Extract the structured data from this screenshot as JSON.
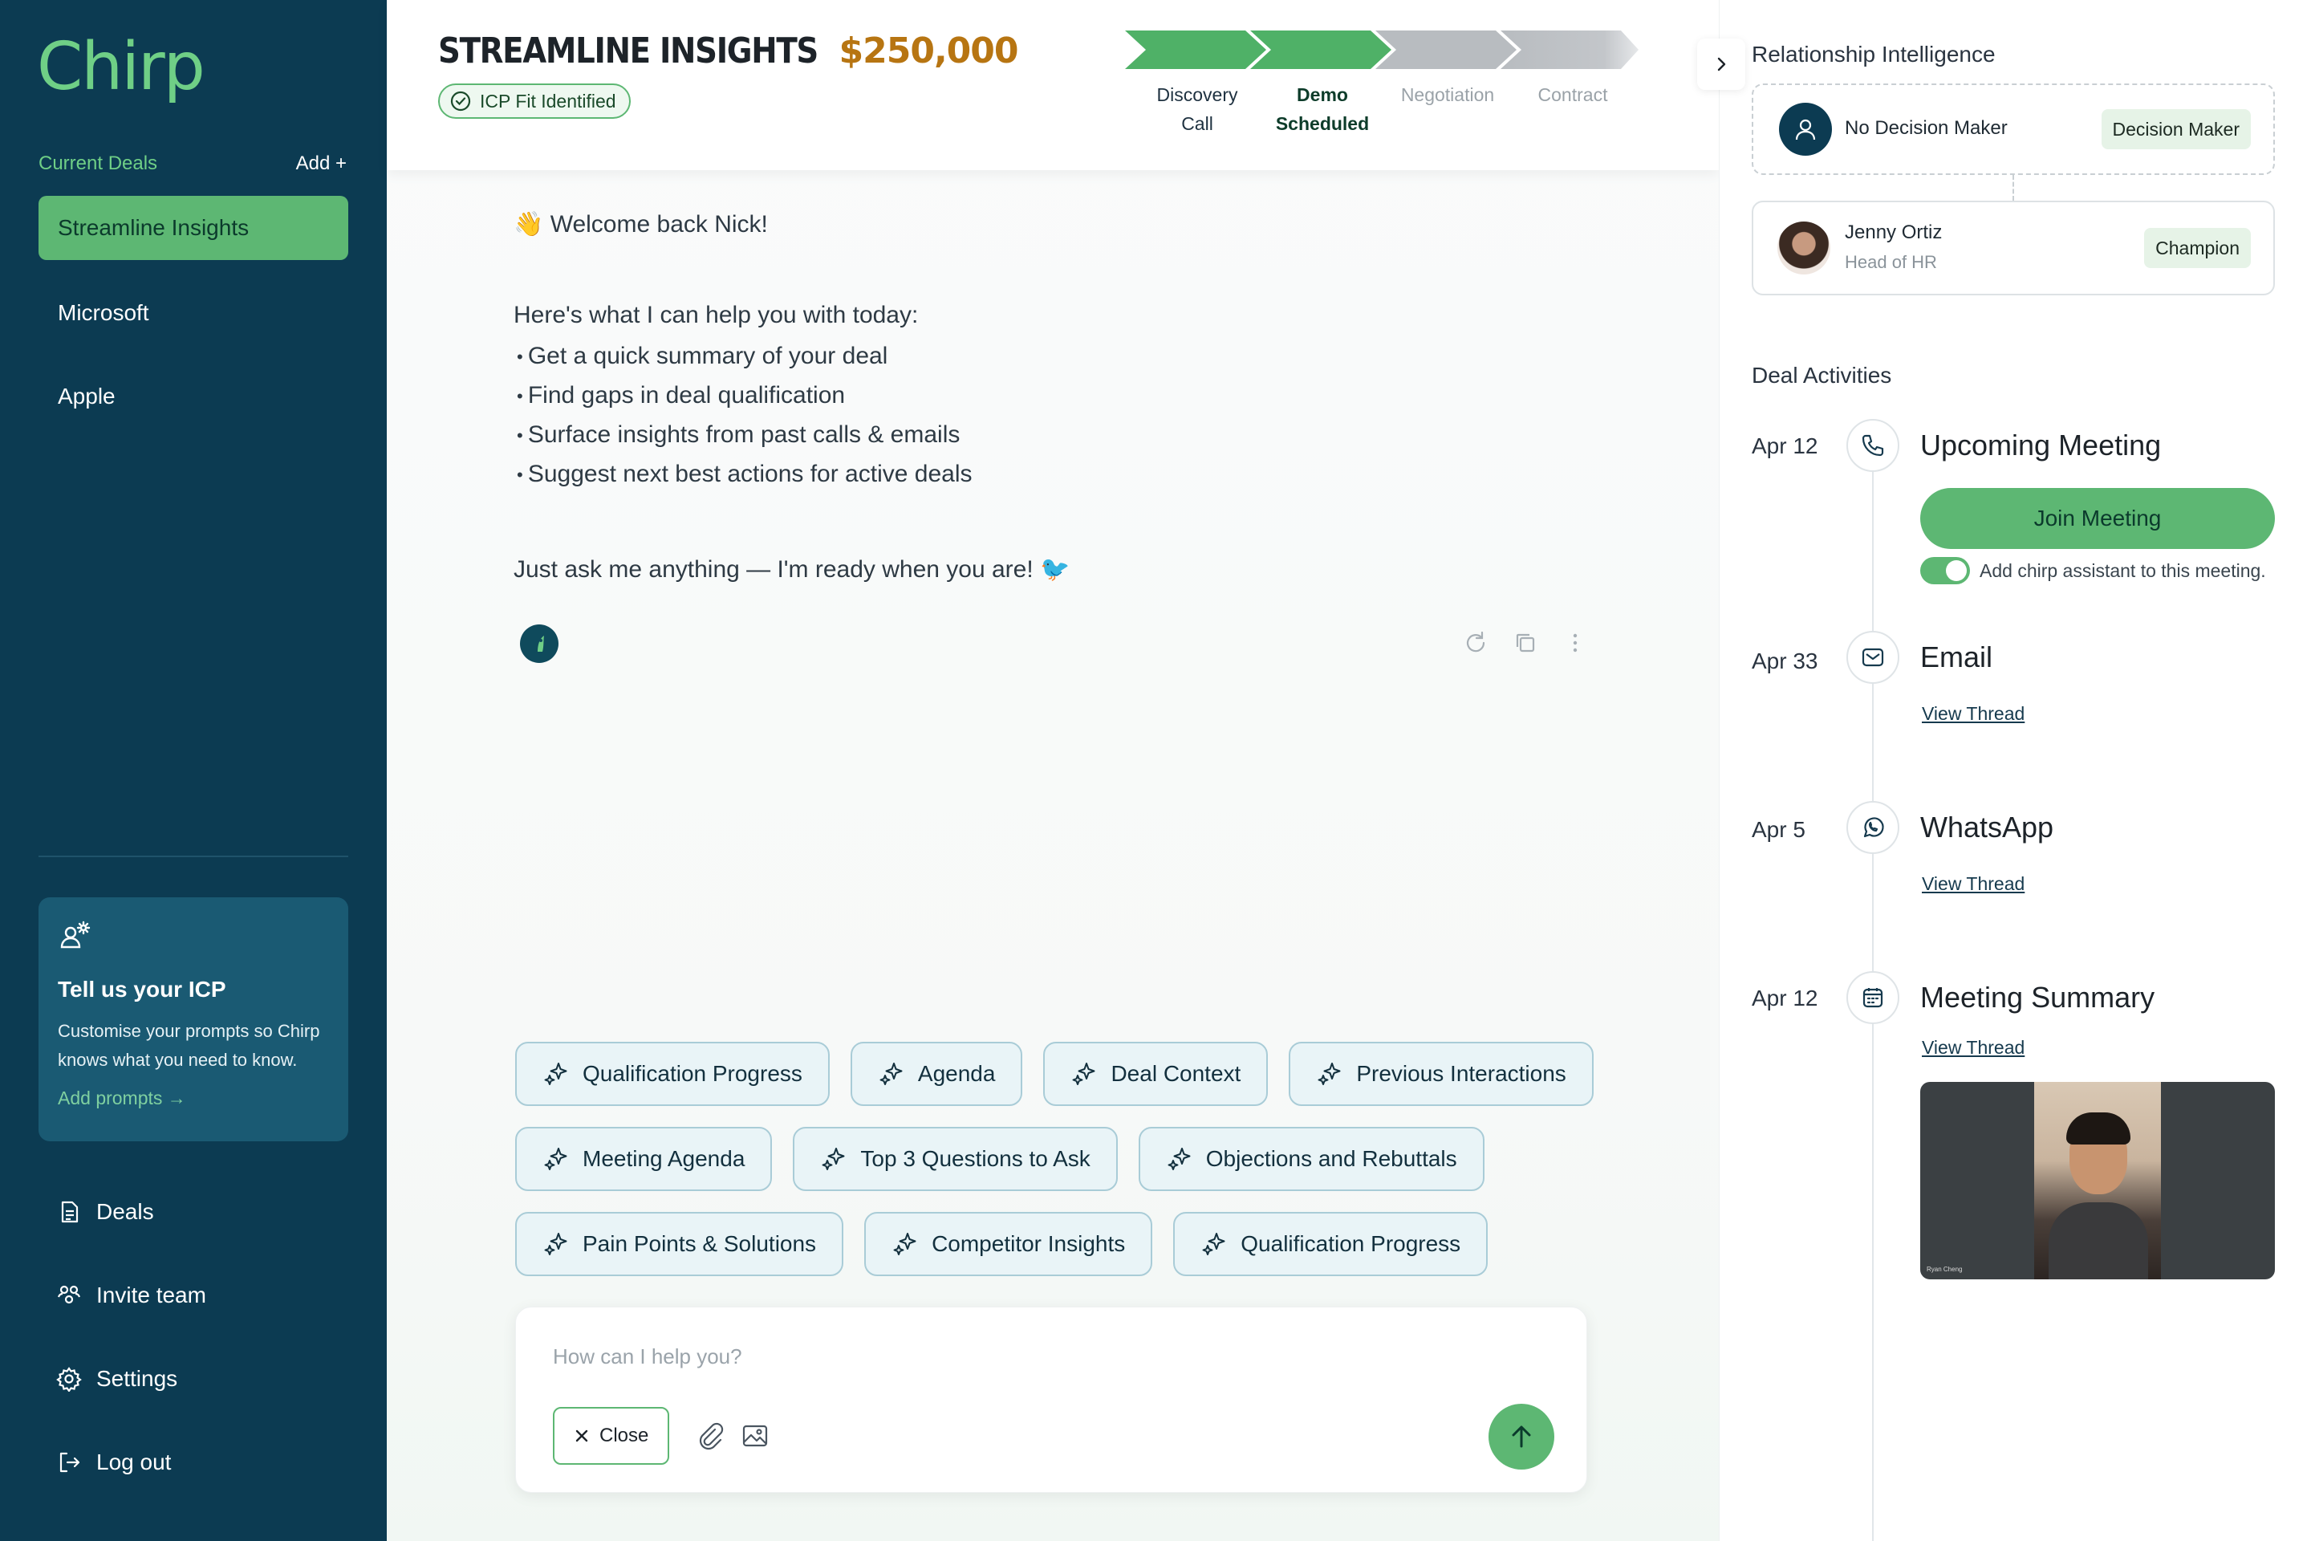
{
  "app": {
    "logo": "Chirp"
  },
  "sidebar": {
    "deals_label": "Current Deals",
    "add_label": "Add +",
    "deals": [
      {
        "label": "Streamline Insights",
        "active": true
      },
      {
        "label": "Microsoft",
        "active": false
      },
      {
        "label": "Apple",
        "active": false
      }
    ],
    "icp_card": {
      "title": "Tell us your ICP",
      "description": "Customise your prompts so Chirp knows what you need to know.",
      "link": "Add prompts →"
    },
    "nav": [
      {
        "label": "Deals",
        "icon": "document-icon"
      },
      {
        "label": "Invite team",
        "icon": "team-icon"
      },
      {
        "label": "Settings",
        "icon": "gear-icon"
      },
      {
        "label": "Log out",
        "icon": "logout-icon"
      }
    ]
  },
  "header": {
    "deal_name": "STREAMLINE INSIGHTS",
    "deal_amount": "$250,000",
    "badge": "ICP Fit Identified",
    "stages": [
      {
        "label": "Discovery Call",
        "line1": "Discovery",
        "line2": "Call",
        "status": "done"
      },
      {
        "label": "Demo Scheduled",
        "line1": "Demo",
        "line2": "Scheduled",
        "status": "current"
      },
      {
        "label": "Negotiation",
        "line1": "Negotiation",
        "line2": "",
        "status": "todo"
      },
      {
        "label": "Contract",
        "line1": "Contract",
        "line2": "",
        "status": "todo"
      }
    ],
    "colors": {
      "done": "#4fb167",
      "todo": "#b8bcc0",
      "accent": "#5db773"
    }
  },
  "chat": {
    "welcome": "👋 Welcome back Nick!",
    "intro": "Here's what I can help you with today:",
    "bullets": [
      "Get a quick summary of your deal",
      "Find gaps in deal qualification",
      "Surface insights from past calls & emails",
      "Suggest next best actions for active deals"
    ],
    "outro": "Just ask me anything — I'm ready when you are! 🐦",
    "chips": [
      [
        "Qualification Progress",
        "Agenda",
        "Deal Context",
        "Previous Interactions"
      ],
      [
        "Meeting Agenda",
        "Top 3 Questions to Ask",
        "Objections and Rebuttals"
      ],
      [
        "Pain Points & Solutions",
        "Competitor Insights",
        "Qualification Progress"
      ]
    ],
    "composer": {
      "placeholder": "How can I help you?",
      "close_label": "Close"
    }
  },
  "right_panel": {
    "title": "Relationship Intelligence",
    "relationships": [
      {
        "name": "No Decision Maker",
        "role": "",
        "tag": "Decision Maker"
      },
      {
        "name": "Jenny Ortiz",
        "role": "Head of HR",
        "tag": "Champion"
      }
    ],
    "activities_title": "Deal Activities",
    "activities": [
      {
        "date": "Apr 12",
        "title": "Upcoming Meeting",
        "icon": "phone-icon",
        "action": "Join Meeting",
        "toggle_label": "Add chirp assistant to this meeting.",
        "toggle_on": true
      },
      {
        "date": "Apr 33",
        "title": "Email",
        "icon": "mail-icon",
        "link": "View Thread"
      },
      {
        "date": "Apr 5",
        "title": "WhatsApp",
        "icon": "whatsapp-icon",
        "link": "View Thread"
      },
      {
        "date": "Apr 12",
        "title": "Meeting Summary",
        "icon": "calendar-icon",
        "link": "View Thread",
        "video_caption": "Ryan Cheng"
      }
    ]
  }
}
